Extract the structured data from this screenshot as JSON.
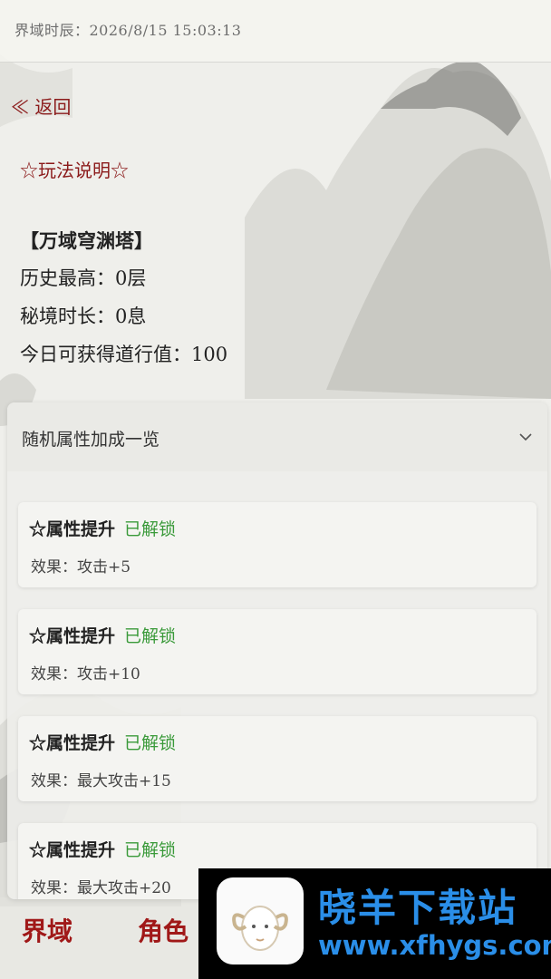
{
  "status_bar": {
    "time_text": "界域时辰：2026/8/15  15:03:13"
  },
  "back_label": "≪ 返回",
  "rules_label": "☆玩法说明☆",
  "tower": {
    "title": "【万域穹渊塔】",
    "lines": [
      "历史最高：0层",
      "秘境时长：0息",
      "今日可获得道行值：100"
    ]
  },
  "bonus_panel": {
    "title": "随机属性加成一览",
    "icon": "chevron-down-icon",
    "cards": [
      {
        "name": "☆属性提升",
        "status": "已解锁",
        "effect": "效果：攻击+5"
      },
      {
        "name": "☆属性提升",
        "status": "已解锁",
        "effect": "效果：攻击+10"
      },
      {
        "name": "☆属性提升",
        "status": "已解锁",
        "effect": "效果：最大攻击+15"
      },
      {
        "name": "☆属性提升",
        "status": "已解锁",
        "effect": "效果：最大攻击+20"
      }
    ]
  },
  "bottom_nav": {
    "items": [
      "界域",
      "角色"
    ]
  },
  "watermark": {
    "name": "晓羊下载站",
    "url": "www.xfhygs.com",
    "icon": "sheep-logo-icon"
  },
  "colors": {
    "accent_red": "#8b1a1a",
    "unlocked_green": "#3a9a3a",
    "watermark_blue": "#2a8ee8"
  }
}
